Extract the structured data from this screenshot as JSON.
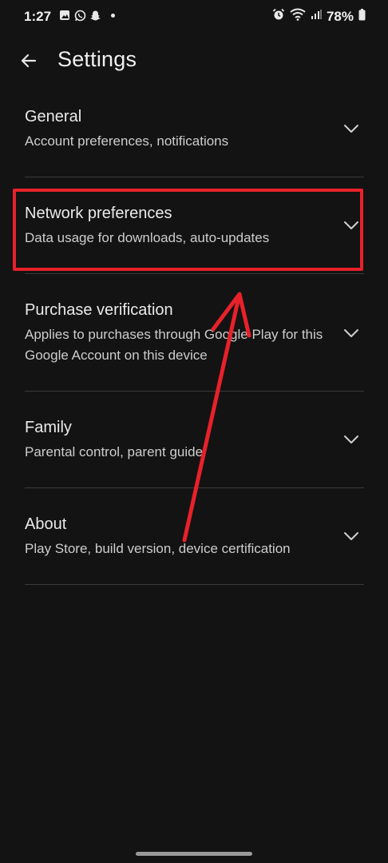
{
  "status_bar": {
    "time": "1:27",
    "battery": "78%",
    "left_icons": [
      "gallery-icon",
      "whatsapp-icon",
      "snapchat-icon"
    ],
    "right_icons": [
      "alarm-icon",
      "wifi-icon",
      "signal-icon",
      "battery-icon"
    ]
  },
  "header": {
    "title": "Settings",
    "back_icon": "arrow-left-icon"
  },
  "settings": {
    "items": [
      {
        "title": "General",
        "subtitle": "Account preferences, notifications"
      },
      {
        "title": "Network preferences",
        "subtitle": "Data usage for downloads, auto-updates"
      },
      {
        "title": "Purchase verification",
        "subtitle": "Applies to purchases through Google Play for this Google Account on this device"
      },
      {
        "title": "Family",
        "subtitle": "Parental control, parent guide"
      },
      {
        "title": "About",
        "subtitle": "Play Store, build version, device certification"
      }
    ]
  },
  "annotation": {
    "highlight_color": "#e8212a",
    "highlighted_item": "Network preferences"
  }
}
